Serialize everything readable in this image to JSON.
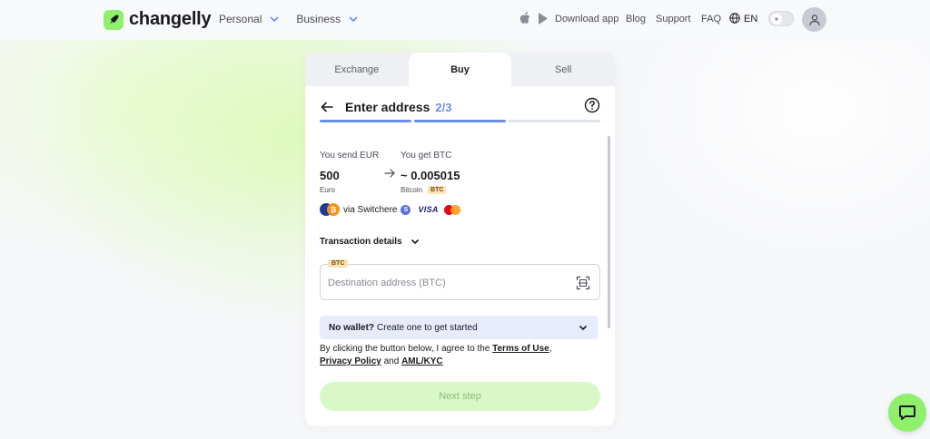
{
  "header": {
    "brand": "changelly",
    "nav_left": [
      {
        "label": "Personal"
      },
      {
        "label": "Business"
      }
    ],
    "download_label": "Download app",
    "blog_label": "Blog",
    "support_label": "Support",
    "faq_label": "FAQ",
    "language": "EN"
  },
  "card": {
    "tabs": [
      {
        "label": "Exchange"
      },
      {
        "label": "Buy"
      },
      {
        "label": "Sell"
      }
    ],
    "step_title": "Enter address",
    "step_count": "2/3",
    "progress_step": 2,
    "progress_total": 3,
    "send": {
      "label": "You send EUR",
      "value": "500",
      "sub": "Euro"
    },
    "get": {
      "label": "You get BTC",
      "value": "~ 0.005015",
      "sub": "Bitcoin",
      "tag": "BTC"
    },
    "provider_text": "via Switchere",
    "card_brand": "VISA",
    "transaction_details_label": "Transaction details",
    "address_tag": "BTC",
    "address_placeholder": "Destination address (BTC)",
    "wallet_bold": "No wallet?",
    "wallet_rest": "Create one to get started",
    "legal_prefix": "By clicking the button below, I agree to the",
    "terms_label": "Terms of Use",
    "legal_comma": ",",
    "privacy_label": "Privacy Policy",
    "legal_and": "and",
    "aml_label": "AML/KYC",
    "next_label": "Next step"
  },
  "colors": {
    "accent_green": "#8ef06b",
    "step_blue": "#6b8fe8",
    "btn_disabled_bg": "#d9f8c8",
    "tag_bg": "#ffe1b3"
  },
  "icons": {
    "logo": "rocket-icon",
    "back": "arrow-left-icon",
    "help": "question-circle-icon",
    "scan": "qr-scan-icon",
    "chat": "chat-bubble-icon"
  }
}
